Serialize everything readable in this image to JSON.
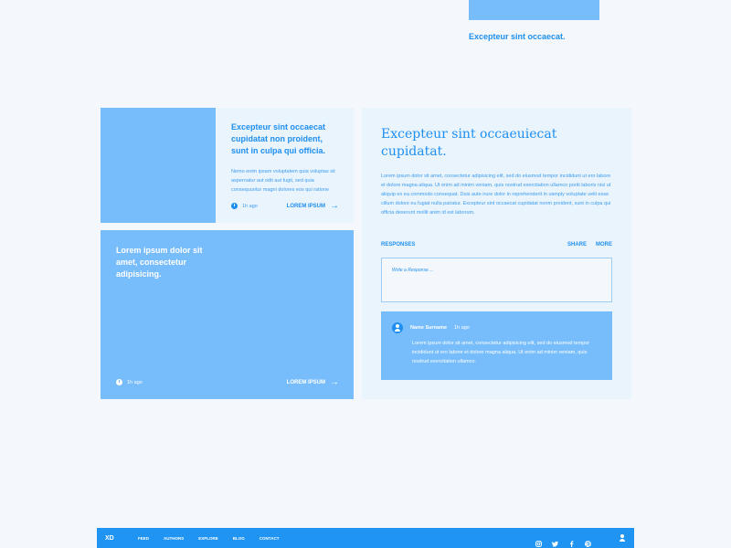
{
  "top": {
    "caption": "Excepteur sint occaecat."
  },
  "card_a": {
    "title": "Excepteur sint occaecat cupidatat non proident, sunt in culpa qui officia.",
    "text": "Nemo enim ipsam voluptatem quia voluptas sit aspernatur aut odit aut fugit, sed quia consequuntur magni dolores eos qui ratione",
    "time": "1h ago",
    "link": "LOREM IPSUM"
  },
  "card_b": {
    "title": "Lorem ipsum dolor sit amet, consectetur adipisicing.",
    "time": "1h ago",
    "link": "LOREM IPSUM"
  },
  "panel": {
    "title": "Excepteur sint occaeuiecat cupidatat.",
    "text": "Lorem ipsum dolor sit amet, consectetur adipisicing elit, sed do eiusmod tempor incididunt ut ero labore et dolore magna aliqua. Ut enim ad minim veniam, quis nostrud exercitation ullamco poriti laboris nisi ut aliquip ex ea commodo consequat. Duis aute irure dolor in reprehenderit in uienply voluptate velit esse cillum dolore eu fugiat nulla pariatur. Excepteur sint occaecat cupidatat nonm proident, sunt in culpa qui officia deserunt mollit anim id est laborum.",
    "responses_label": "RESPONSES",
    "share_label": "SHARE",
    "more_label": "MORE",
    "response_placeholder": "Write a Response ...",
    "comment": {
      "name": "Name Surname",
      "time": "1h ago",
      "text": "Lorem ipsum dolor sit amet, consectetur adipisicing elit, sed do eiusmod tempor incididunt ut ero labore et dolore magna aliqua. Ut enim ad minim veniam, quis nostrud exercitation ullamco."
    }
  },
  "footer": {
    "logo": "XD",
    "nav": [
      "FEED",
      "AUTHORS",
      "EXPLORE",
      "BLOG",
      "CONTACT"
    ],
    "social_icons": [
      "instagram-icon",
      "twitter-icon",
      "facebook-icon",
      "dribbble-icon"
    ],
    "profile_icon": "profile-icon"
  }
}
